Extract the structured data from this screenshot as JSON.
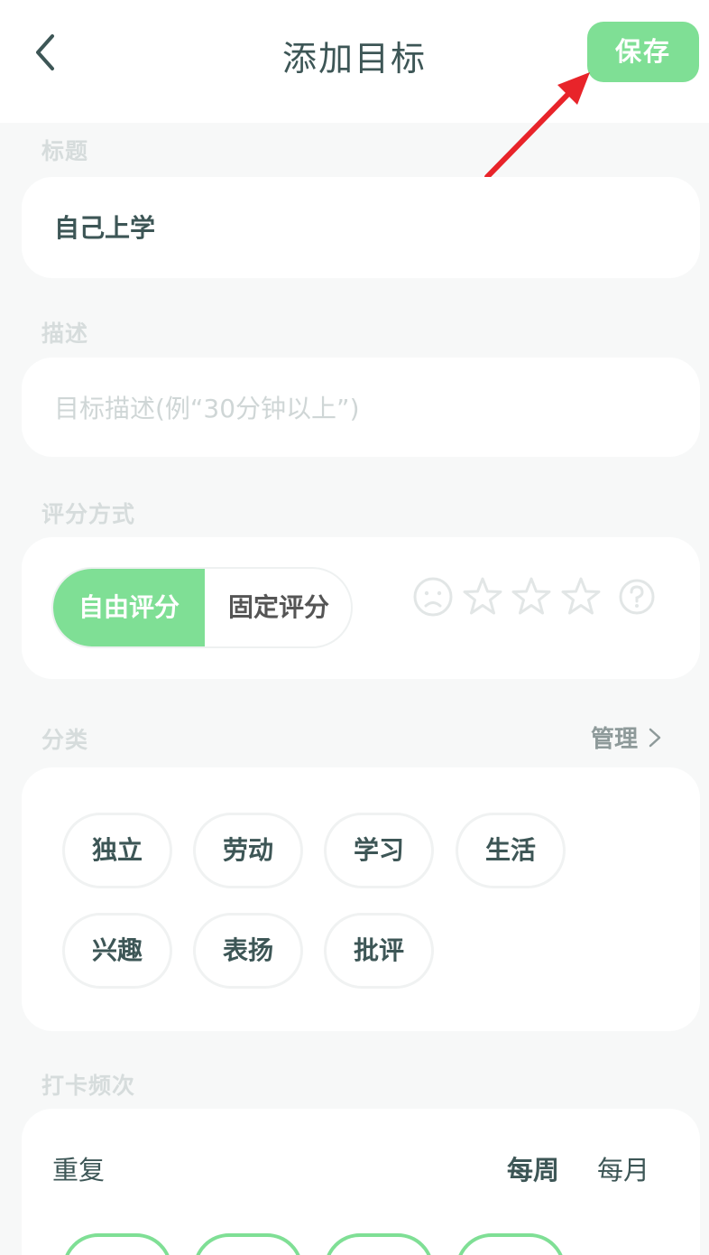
{
  "header": {
    "title": "添加目标",
    "save_label": "保存"
  },
  "title_section": {
    "label": "标题",
    "value": "自己上学"
  },
  "description_section": {
    "label": "描述",
    "placeholder": "目标描述(例“30分钟以上”)"
  },
  "rating_section": {
    "label": "评分方式",
    "options": [
      "自由评分",
      "固定评分"
    ],
    "selected": "自由评分",
    "icons": [
      "sad-face-icon",
      "star-icon",
      "star-icon",
      "star-icon",
      "help-icon"
    ]
  },
  "category_section": {
    "label": "分类",
    "manage_label": "管理",
    "chips": [
      "独立",
      "劳动",
      "学习",
      "生活",
      "兴趣",
      "表扬",
      "批评"
    ]
  },
  "frequency_section": {
    "label": "打卡频次",
    "repeat_label": "重复",
    "options": [
      "每周",
      "每月"
    ],
    "selected": "每周"
  },
  "colors": {
    "accent": "#7fdf95",
    "text": "#3d5656",
    "annotation_arrow": "#e8242a"
  }
}
